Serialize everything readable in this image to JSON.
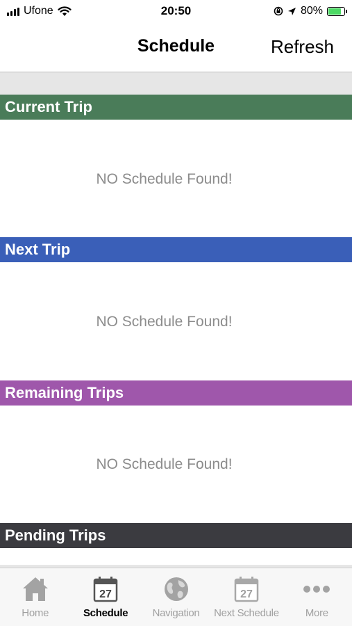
{
  "status_bar": {
    "carrier": "Ufone",
    "time": "20:50",
    "battery_percent": "80%",
    "battery_level": 0.8,
    "icons": [
      "signal-icon",
      "wifi-icon",
      "rotation-lock-icon",
      "location-arrow-icon",
      "battery-icon"
    ]
  },
  "nav": {
    "title": "Schedule",
    "refresh_label": "Refresh"
  },
  "sections": [
    {
      "title": "Current Trip",
      "color": "#4a7c59",
      "empty_message": "NO Schedule Found!"
    },
    {
      "title": "Next Trip",
      "color": "#3a5fb8",
      "empty_message": "NO Schedule Found!"
    },
    {
      "title": "Remaining Trips",
      "color": "#9f57ab",
      "empty_message": "NO Schedule Found!"
    },
    {
      "title": "Pending Trips",
      "color": "#3b3b40"
    }
  ],
  "tabs": [
    {
      "label": "Home",
      "icon": "home-icon",
      "active": false
    },
    {
      "label": "Schedule",
      "icon": "calendar-icon",
      "calendar_day": "27",
      "active": true
    },
    {
      "label": "Navigation",
      "icon": "globe-icon",
      "active": false
    },
    {
      "label": "Next Schedule",
      "icon": "calendar-icon",
      "calendar_day": "27",
      "active": false
    },
    {
      "label": "More",
      "icon": "more-icon",
      "active": false
    }
  ],
  "colors": {
    "active_tab": "#000000",
    "inactive_tab": "#a0a0a0",
    "empty_text": "#8c8c8c"
  }
}
